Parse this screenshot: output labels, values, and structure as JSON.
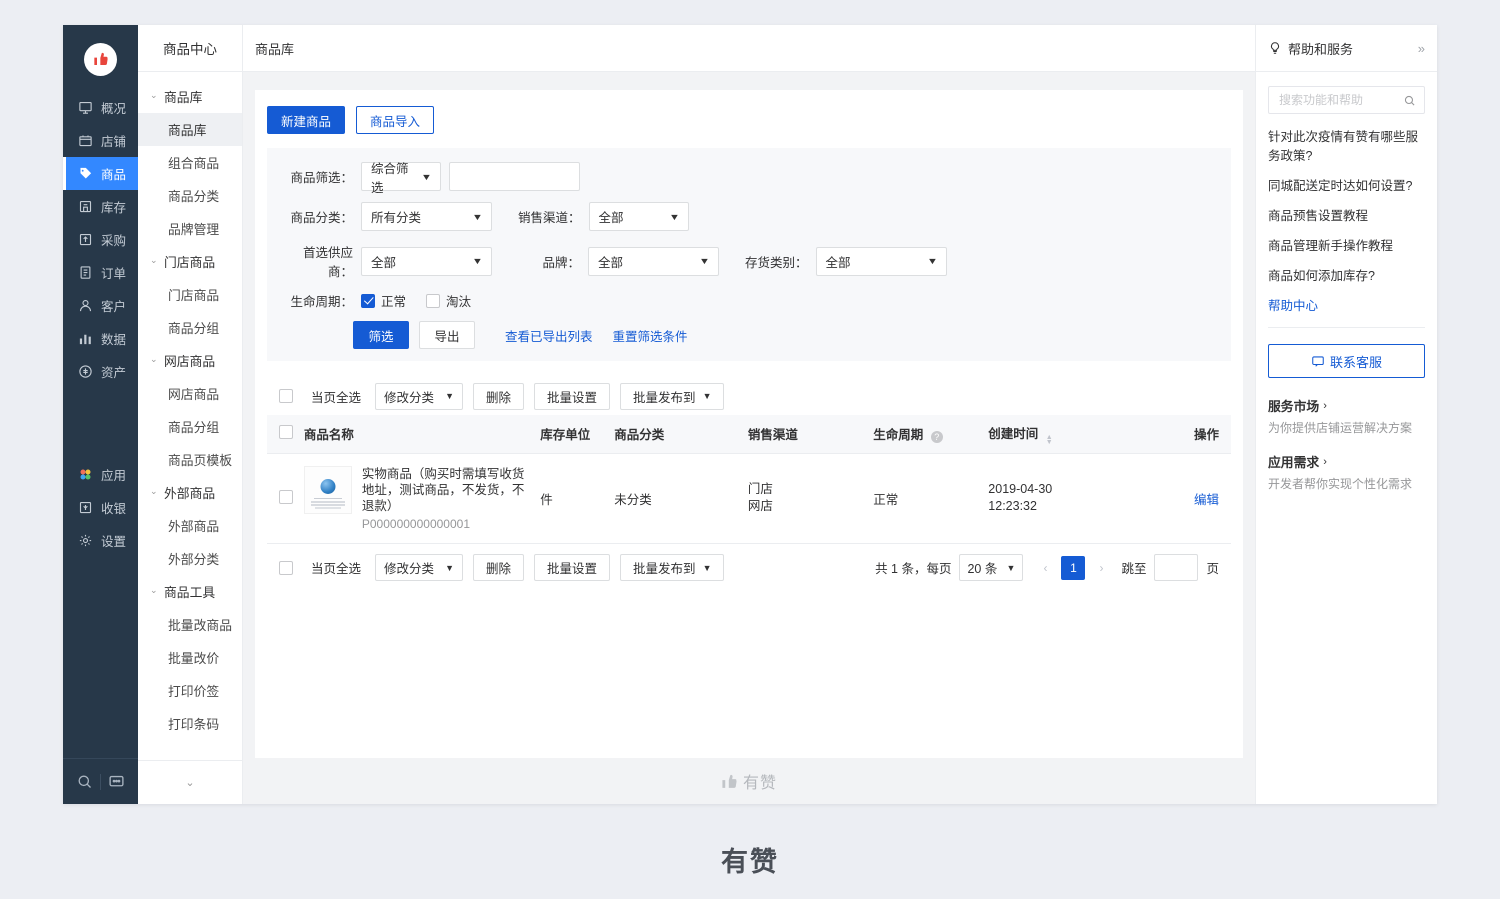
{
  "rail": {
    "logo_icon": "thumbs-up-logo",
    "items": [
      {
        "label": "概况",
        "icon": "overview-icon",
        "active": false
      },
      {
        "label": "店铺",
        "icon": "shop-icon",
        "active": false
      },
      {
        "label": "商品",
        "icon": "tag-icon",
        "active": true
      },
      {
        "label": "库存",
        "icon": "warehouse-icon",
        "active": false
      },
      {
        "label": "采购",
        "icon": "purchase-icon",
        "active": false
      },
      {
        "label": "订单",
        "icon": "order-icon",
        "active": false
      },
      {
        "label": "客户",
        "icon": "customer-icon",
        "active": false
      },
      {
        "label": "数据",
        "icon": "chart-icon",
        "active": false
      },
      {
        "label": "资产",
        "icon": "asset-icon",
        "active": false
      }
    ],
    "items2": [
      {
        "label": "应用",
        "icon": "apps-icon",
        "active": false
      },
      {
        "label": "收银",
        "icon": "cashier-icon",
        "active": false
      },
      {
        "label": "设置",
        "icon": "gear-icon",
        "active": false
      }
    ],
    "bottom": [
      {
        "icon": "search-icon"
      },
      {
        "icon": "message-icon"
      }
    ]
  },
  "subnav": {
    "title": "商品中心",
    "groups": [
      {
        "label": "商品库",
        "items": [
          {
            "label": "商品库",
            "active": true
          },
          {
            "label": "组合商品",
            "active": false
          },
          {
            "label": "商品分类",
            "active": false
          },
          {
            "label": "品牌管理",
            "active": false
          }
        ]
      },
      {
        "label": "门店商品",
        "items": [
          {
            "label": "门店商品",
            "active": false
          },
          {
            "label": "商品分组",
            "active": false
          }
        ]
      },
      {
        "label": "网店商品",
        "items": [
          {
            "label": "网店商品",
            "active": false
          },
          {
            "label": "商品分组",
            "active": false
          },
          {
            "label": "商品页模板",
            "active": false
          }
        ]
      },
      {
        "label": "外部商品",
        "items": [
          {
            "label": "外部商品",
            "active": false
          },
          {
            "label": "外部分类",
            "active": false
          }
        ]
      },
      {
        "label": "商品工具",
        "items": [
          {
            "label": "批量改商品",
            "active": false
          },
          {
            "label": "批量改价",
            "active": false
          },
          {
            "label": "打印价签",
            "active": false
          },
          {
            "label": "打印条码",
            "active": false
          }
        ]
      }
    ],
    "collapse_icon": "chevron-down-icon"
  },
  "breadcrumb": {
    "current": "商品库"
  },
  "toolbar": {
    "create_label": "新建商品",
    "import_label": "商品导入"
  },
  "filters": {
    "product_filter_label": "商品筛选：",
    "product_filter_value": "综合筛选",
    "keyword_value": "",
    "category_label": "商品分类：",
    "category_value": "所有分类",
    "channel_label": "销售渠道：",
    "channel_value": "全部",
    "supplier_label": "首选供应商：",
    "supplier_value": "全部",
    "brand_label": "品牌：",
    "brand_value": "全部",
    "stock_type_label": "存货类别：",
    "stock_type_value": "全部",
    "lifecycle_label": "生命周期：",
    "lifecycle_normal": "正常",
    "lifecycle_obsolete": "淘汰",
    "filter_btn": "筛选",
    "export_btn": "导出",
    "view_exported_link": "查看已导出列表",
    "reset_link": "重置筛选条件"
  },
  "batch": {
    "select_all_label": "当页全选",
    "change_category": "修改分类",
    "delete": "删除",
    "bulk_settings": "批量设置",
    "bulk_publish": "批量发布到"
  },
  "table": {
    "columns": {
      "name": "商品名称",
      "unit": "库存单位",
      "category": "商品分类",
      "channel": "销售渠道",
      "lifecycle": "生命周期",
      "created": "创建时间",
      "action": "操作"
    },
    "rows": [
      {
        "name": "实物商品（购买时需填写收货地址，测试商品，不发货，不退款）",
        "code": "P000000000000001",
        "unit": "件",
        "category": "未分类",
        "channel_line1": "门店",
        "channel_line2": "网店",
        "lifecycle": "正常",
        "created_date": "2019-04-30",
        "created_time": "12:23:32",
        "action": "编辑",
        "thumb_icon": "product-thumbnail"
      }
    ]
  },
  "pagination": {
    "total_text": "共 1 条，每页",
    "page_size": "20 条",
    "prev_icon": "chevron-left-icon",
    "current_page": "1",
    "next_icon": "chevron-right-icon",
    "jump_label": "跳至",
    "jump_value": "",
    "page_unit": "页"
  },
  "app_footer": {
    "brand": "有赞",
    "icon": "thumbs-up-icon"
  },
  "help": {
    "title": "帮助和服务",
    "title_icon": "bulb-icon",
    "expand_icon": "double-chevron-right-icon",
    "search_placeholder": "搜索功能和帮助",
    "search_value": "",
    "search_icon": "search-icon",
    "links": [
      {
        "text": "针对此次疫情有赞有哪些服务政策?",
        "blue": false
      },
      {
        "text": "同城配送定时达如何设置?",
        "blue": false
      },
      {
        "text": "商品预售设置教程",
        "blue": false
      },
      {
        "text": "商品管理新手操作教程",
        "blue": false
      },
      {
        "text": "商品如何添加库存?",
        "blue": false
      },
      {
        "text": "帮助中心",
        "blue": true
      }
    ],
    "contact_btn": "联系客服",
    "contact_icon": "chat-icon",
    "blocks": [
      {
        "title": "服务市场",
        "arrow": "›",
        "desc": "为你提供店铺运营解决方案"
      },
      {
        "title": "应用需求",
        "arrow": "›",
        "desc": "开发者帮你实现个性化需求"
      }
    ]
  },
  "watermark": {
    "text": "有赞"
  }
}
